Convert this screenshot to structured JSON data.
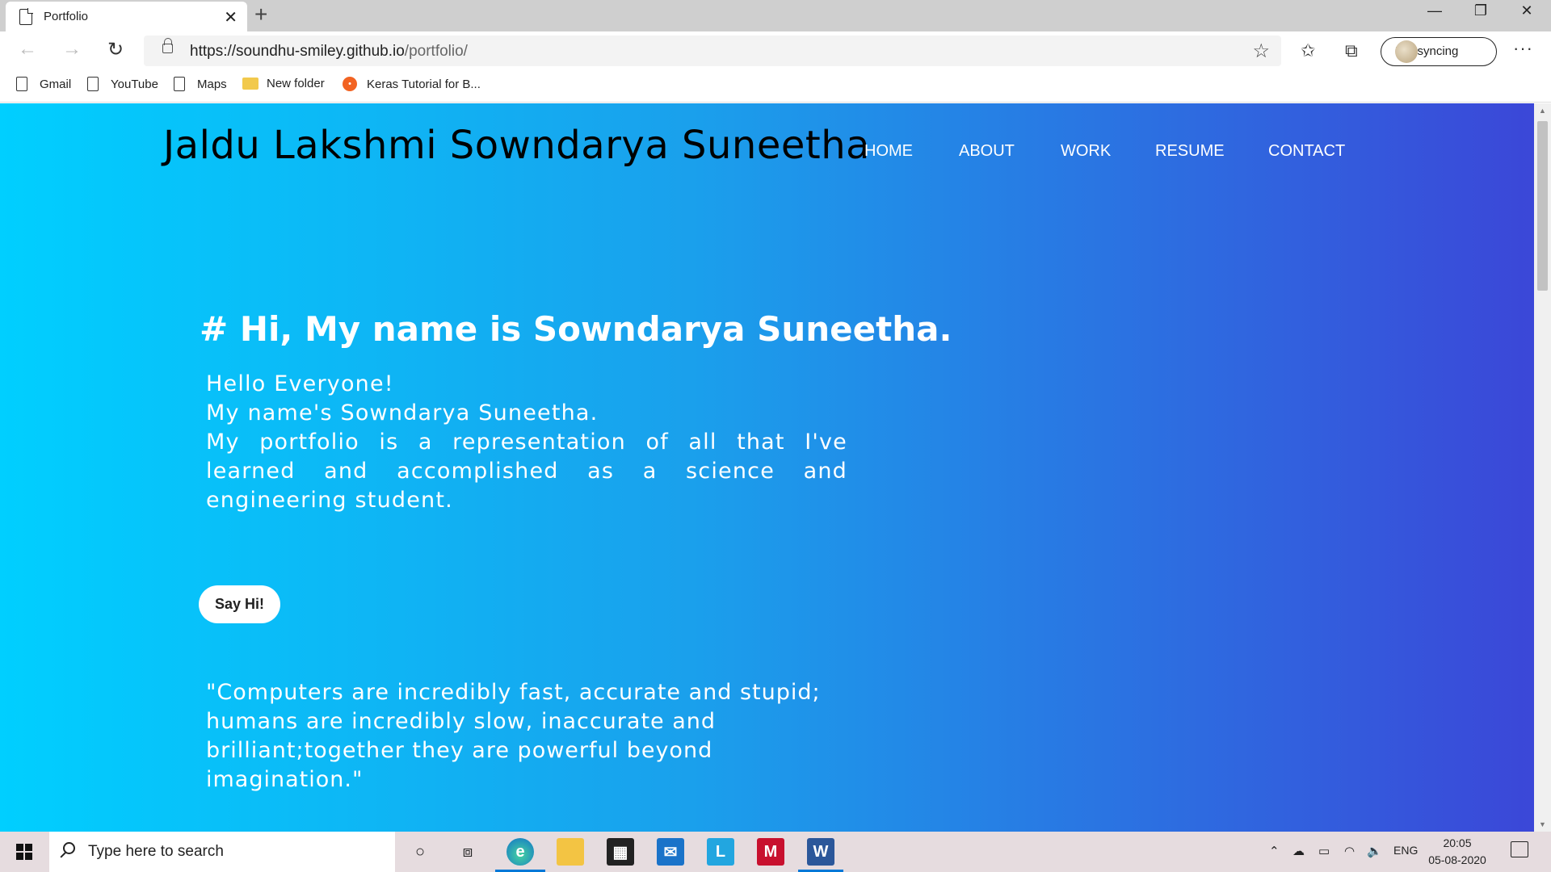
{
  "browser": {
    "tab_title": "Portfolio",
    "tab_close": "✕",
    "new_tab": "+",
    "window_controls": {
      "minimize": "—",
      "restore": "❐",
      "close": "✕"
    },
    "nav": {
      "back": "←",
      "forward": "→",
      "reload": "↻"
    },
    "url_host": "https://soundhu-smiley.github.io",
    "url_path": "/portfolio/",
    "favorite_icon": "☆",
    "sync_label": "Not syncing",
    "more_label": "···",
    "bookmarks": [
      {
        "label": "Gmail",
        "icon": "page-icon"
      },
      {
        "label": "YouTube",
        "icon": "page-icon"
      },
      {
        "label": "Maps",
        "icon": "page-icon"
      },
      {
        "label": "New folder",
        "icon": "folder-icon"
      },
      {
        "label": "Keras Tutorial for B...",
        "icon": "keras-icon"
      }
    ]
  },
  "site": {
    "brand": "Jaldu Lakshmi Sowndarya Suneetha",
    "nav": [
      "HOME",
      "ABOUT",
      "WORK",
      "RESUME",
      "CONTACT"
    ],
    "heading": "# Hi, My name is Sowndarya Suneetha.",
    "intro_line1": "Hello Everyone!",
    "intro_line2": "My name's Sowndarya Suneetha.",
    "intro_line3": "My portfolio is a representation of all that I've learned and accomplished as a science and engineering student.",
    "button_label": "Say Hi!",
    "quote": "\"Computers are incredibly fast, accurate and stupid; humans are incredibly slow, inaccurate and brilliant;together they are powerful beyond imagination.\"",
    "gradient_colors": [
      "#00cfff",
      "#1aa0ec",
      "#3b47d8"
    ]
  },
  "taskbar": {
    "search_placeholder": "Type here to search",
    "tray_language": "ENG",
    "time": "20:05",
    "date": "05-08-2020"
  }
}
